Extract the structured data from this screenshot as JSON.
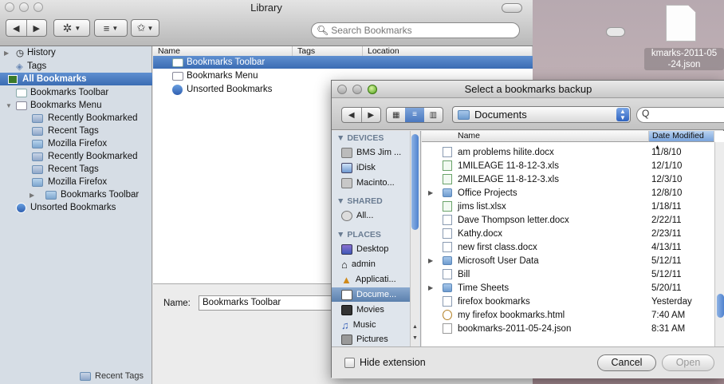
{
  "library": {
    "title": "Library",
    "search_placeholder": "Search Bookmarks",
    "sidebar": {
      "items": [
        {
          "label": "History"
        },
        {
          "label": "Tags"
        },
        {
          "label": "All Bookmarks"
        },
        {
          "label": "Bookmarks Toolbar"
        },
        {
          "label": "Bookmarks Menu"
        },
        {
          "label": "Recently Bookmarked"
        },
        {
          "label": "Recent Tags"
        },
        {
          "label": "Mozilla Firefox"
        },
        {
          "label": "Recently Bookmarked"
        },
        {
          "label": "Recent Tags"
        },
        {
          "label": "Mozilla Firefox"
        },
        {
          "label": "Bookmarks Toolbar"
        },
        {
          "label": "Unsorted Bookmarks"
        }
      ],
      "bottom_item": "Recent Tags"
    },
    "columns": {
      "name": "Name",
      "tags": "Tags",
      "location": "Location"
    },
    "rows": [
      {
        "name": "Bookmarks Toolbar"
      },
      {
        "name": "Bookmarks Menu"
      },
      {
        "name": "Unsorted Bookmarks"
      }
    ],
    "detail": {
      "name_label": "Name:",
      "name_value": "Bookmarks Toolbar"
    }
  },
  "desktop": {
    "file_caption_1": "kmarks-2011-05",
    "file_caption_2": "-24.json"
  },
  "sheet": {
    "title": "Select a bookmarks backup",
    "location": "Documents",
    "search_value": "Q",
    "sidebar": {
      "devices_header": "DEVICES",
      "devices": [
        "BMS Jim ...",
        "iDisk",
        "Macinto..."
      ],
      "shared_header": "SHARED",
      "shared": [
        "All..."
      ],
      "places_header": "PLACES",
      "places": [
        "Desktop",
        "admin",
        "Applicati...",
        "Docume...",
        "Movies",
        "Music",
        "Pictures"
      ]
    },
    "columns": {
      "name": "Name",
      "date": "Date Modified"
    },
    "files": [
      {
        "name": "am problems hilite.docx",
        "date": "11/8/10",
        "kind": "doc"
      },
      {
        "name": "1MILEAGE 11-8-12-3.xls",
        "date": "12/1/10",
        "kind": "xls"
      },
      {
        "name": "2MILEAGE 11-8-12-3.xls",
        "date": "12/3/10",
        "kind": "xls"
      },
      {
        "name": "Office Projects",
        "date": "12/8/10",
        "kind": "folder"
      },
      {
        "name": "jims list.xlsx",
        "date": "1/18/11",
        "kind": "xls"
      },
      {
        "name": "Dave Thompson letter.docx",
        "date": "2/22/11",
        "kind": "doc"
      },
      {
        "name": "Kathy.docx",
        "date": "2/23/11",
        "kind": "doc"
      },
      {
        "name": "new first class.docx",
        "date": "4/13/11",
        "kind": "doc"
      },
      {
        "name": "Microsoft User Data",
        "date": "5/12/11",
        "kind": "folder"
      },
      {
        "name": "Bill",
        "date": "5/12/11",
        "kind": "doc"
      },
      {
        "name": "Time Sheets",
        "date": "5/20/11",
        "kind": "folder"
      },
      {
        "name": "firefox bookmarks",
        "date": "Yesterday",
        "kind": "doc"
      },
      {
        "name": "my firefox bookmarks.html",
        "date": "7:40 AM",
        "kind": "html"
      },
      {
        "name": "bookmarks-2011-05-24.json",
        "date": "8:31 AM",
        "kind": "json"
      }
    ],
    "hide_extension_label": "Hide extension",
    "cancel_label": "Cancel",
    "open_label": "Open"
  }
}
